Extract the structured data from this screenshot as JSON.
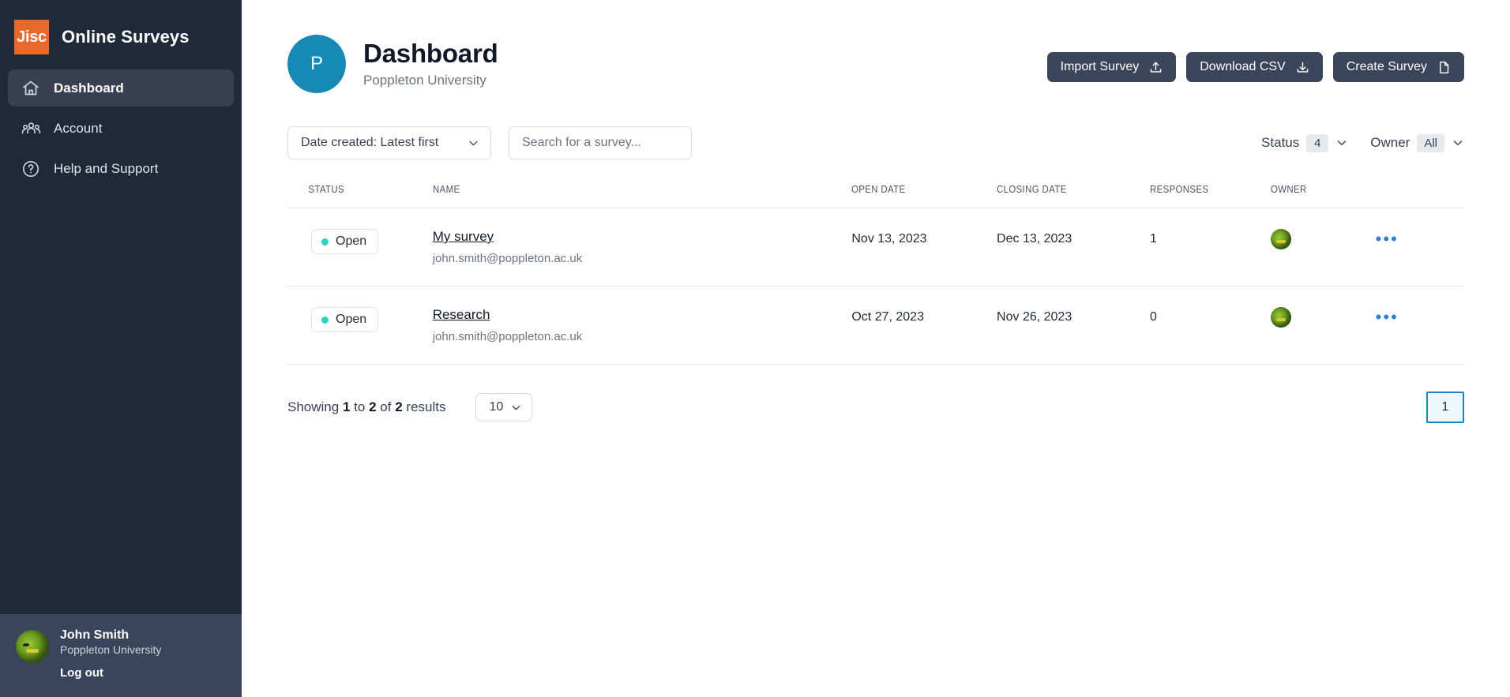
{
  "sidebar": {
    "brand": {
      "logo_text": "Jisc",
      "title": "Online Surveys",
      "logo_color": "#e8692a"
    },
    "items": [
      {
        "label": "Dashboard",
        "icon": "home-icon",
        "active": true
      },
      {
        "label": "Account",
        "icon": "users-icon",
        "active": false
      },
      {
        "label": "Help and Support",
        "icon": "question-circle-icon",
        "active": false
      }
    ],
    "footer": {
      "name": "John Smith",
      "org": "Poppleton University",
      "logout_label": "Log out"
    }
  },
  "header": {
    "avatar_initial": "P",
    "avatar_color": "#1789b5",
    "title": "Dashboard",
    "subtitle": "Poppleton University",
    "actions": [
      {
        "label": "Import Survey",
        "icon": "upload-icon"
      },
      {
        "label": "Download CSV",
        "icon": "download-icon"
      },
      {
        "label": "Create Survey",
        "icon": "document-icon"
      }
    ]
  },
  "filters": {
    "sort_value": "Date created: Latest first",
    "search_placeholder": "Search for a survey...",
    "search_value": "",
    "status_label": "Status",
    "status_count": "4",
    "owner_label": "Owner",
    "owner_value": "All"
  },
  "table": {
    "columns": [
      "STATUS",
      "NAME",
      "OPEN DATE",
      "CLOSING DATE",
      "RESPONSES",
      "OWNER"
    ],
    "rows": [
      {
        "status": "Open",
        "status_color": "#2dd4bf",
        "name": "My survey",
        "email": "john.smith@poppleton.ac.uk",
        "open_date": "Nov 13, 2023",
        "closing_date": "Dec 13, 2023",
        "responses": "1",
        "menu": "•••"
      },
      {
        "status": "Open",
        "status_color": "#2dd4bf",
        "name": "Research",
        "email": "john.smith@poppleton.ac.uk",
        "open_date": "Oct 27, 2023",
        "closing_date": "Nov 26, 2023",
        "responses": "0",
        "menu": "•••"
      }
    ]
  },
  "pagination": {
    "showing_prefix": "Showing",
    "from": "1",
    "to_word": "to",
    "to": "2",
    "of_word": "of",
    "total": "2",
    "results_word": "results",
    "per_page": "10",
    "current_page": "1"
  }
}
